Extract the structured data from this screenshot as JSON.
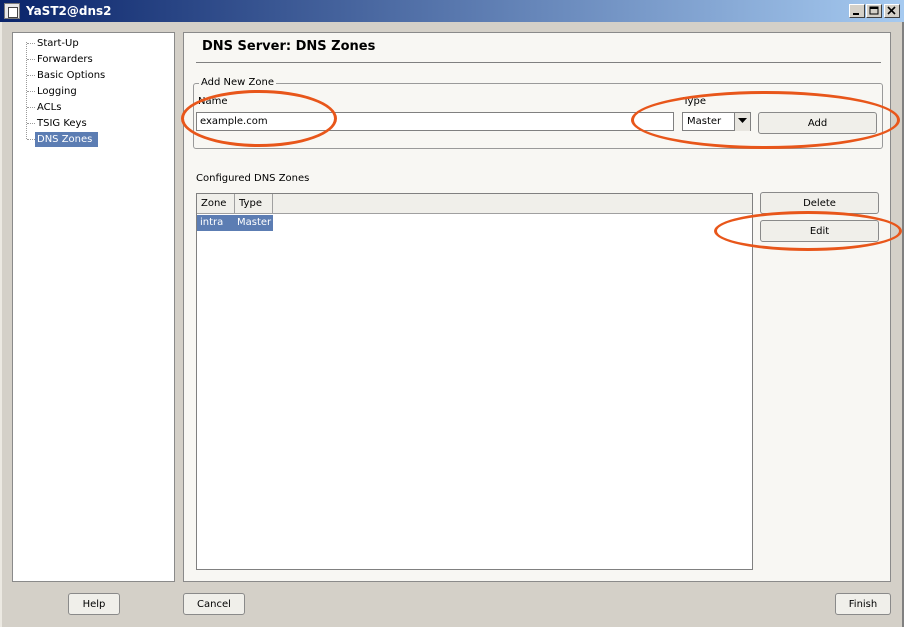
{
  "window": {
    "title": "YaST2@dns2"
  },
  "sidebar": {
    "items": [
      {
        "label": "Start-Up"
      },
      {
        "label": "Forwarders"
      },
      {
        "label": "Basic Options"
      },
      {
        "label": "Logging"
      },
      {
        "label": "ACLs"
      },
      {
        "label": "TSIG Keys"
      },
      {
        "label": "DNS Zones",
        "selected": true
      }
    ]
  },
  "main": {
    "title": "DNS Server: DNS Zones",
    "add_zone": {
      "legend": "Add New Zone",
      "name_label": "Name",
      "name_value": "example.com",
      "type_label": "Type",
      "type_value": "Master",
      "add_button": "Add"
    },
    "configured": {
      "label": "Configured DNS Zones",
      "columns": [
        "Zone",
        "Type"
      ],
      "rows": [
        {
          "zone": "intra",
          "type": "Master"
        }
      ],
      "delete_button": "Delete",
      "edit_button": "Edit"
    }
  },
  "footer": {
    "help_button": "Help",
    "cancel_button": "Cancel",
    "finish_button": "Finish"
  },
  "colors": {
    "annotation": "#e8561a",
    "selection": "#5c7db3",
    "titlebar": "#0a246a"
  }
}
